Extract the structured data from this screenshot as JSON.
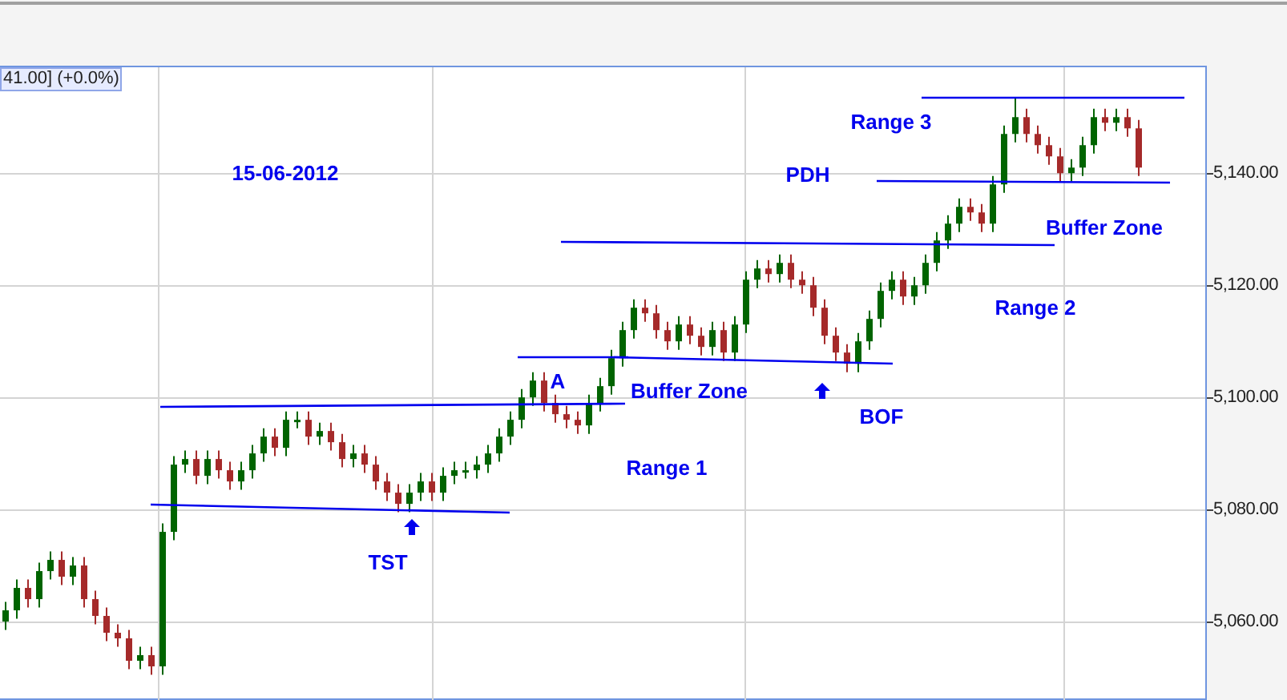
{
  "price_tag": "41.00] (+0.0%)",
  "annotations": [
    {
      "text": "15-06-2012"
    },
    {
      "text": "Range 3"
    },
    {
      "text": "PDH"
    },
    {
      "text": "Buffer Zone"
    },
    {
      "text": "Range 2"
    },
    {
      "text": "A"
    },
    {
      "text": "Buffer Zone"
    },
    {
      "text": "BOF"
    },
    {
      "text": "Range 1"
    },
    {
      "text": "TST"
    }
  ],
  "chart_data": {
    "type": "candlestick",
    "grid": true,
    "ylim": [
      5046,
      5158.9
    ],
    "yticks": [
      {
        "value": 5140,
        "label": "5,140.00"
      },
      {
        "value": 5120,
        "label": "5,120.00"
      },
      {
        "value": 5100,
        "label": "5,100.00"
      },
      {
        "value": 5080,
        "label": "5,080.00"
      },
      {
        "value": 5060,
        "label": "5,060.00"
      }
    ],
    "ohlc": [
      [
        5060,
        5063.5,
        5058.5,
        5062
      ],
      [
        5062,
        5067.5,
        5060.5,
        5066
      ],
      [
        5066,
        5067.5,
        5062.5,
        5064
      ],
      [
        5064,
        5070.5,
        5062.5,
        5069
      ],
      [
        5069,
        5072.5,
        5067.5,
        5071
      ],
      [
        5071,
        5072.5,
        5066.5,
        5068
      ],
      [
        5068,
        5071.5,
        5066.5,
        5070
      ],
      [
        5070,
        5071.5,
        5062.5,
        5064
      ],
      [
        5064,
        5065.5,
        5059.5,
        5061
      ],
      [
        5061,
        5062.5,
        5056.5,
        5058
      ],
      [
        5058,
        5059.5,
        5055.5,
        5057
      ],
      [
        5057,
        5058.5,
        5051.5,
        5053
      ],
      [
        5053,
        5055.5,
        5051.5,
        5054
      ],
      [
        5054,
        5055.5,
        5050.5,
        5052
      ],
      [
        5052,
        5077.5,
        5050.5,
        5076
      ],
      [
        5076,
        5089.5,
        5074.5,
        5088
      ],
      [
        5088,
        5090.5,
        5086.5,
        5089
      ],
      [
        5089,
        5090.5,
        5084.5,
        5086
      ],
      [
        5086,
        5090.5,
        5084.5,
        5089
      ],
      [
        5089,
        5090.5,
        5085.5,
        5087
      ],
      [
        5087,
        5088.5,
        5083.5,
        5085
      ],
      [
        5085,
        5088.5,
        5083.5,
        5087
      ],
      [
        5087,
        5091.5,
        5085.5,
        5090
      ],
      [
        5090,
        5094.5,
        5088.5,
        5093
      ],
      [
        5093,
        5094.5,
        5089.5,
        5091
      ],
      [
        5091,
        5097.5,
        5089.5,
        5096
      ],
      [
        5096,
        5097.5,
        5094.5,
        5096
      ],
      [
        5096,
        5097.5,
        5091.5,
        5093
      ],
      [
        5093,
        5095.5,
        5091.5,
        5094
      ],
      [
        5094,
        5095.5,
        5090.5,
        5092
      ],
      [
        5092,
        5093.5,
        5087.5,
        5089
      ],
      [
        5089,
        5091.5,
        5087.5,
        5090
      ],
      [
        5090,
        5091.5,
        5086.5,
        5088
      ],
      [
        5088,
        5089.5,
        5083.5,
        5085
      ],
      [
        5085,
        5086.5,
        5081.5,
        5083
      ],
      [
        5083,
        5084.5,
        5079.5,
        5081
      ],
      [
        5081,
        5084.5,
        5079.5,
        5083
      ],
      [
        5083,
        5086.5,
        5081.5,
        5085
      ],
      [
        5085,
        5086.5,
        5081.5,
        5083
      ],
      [
        5083,
        5087.5,
        5081.5,
        5086
      ],
      [
        5086,
        5088.5,
        5084.5,
        5087
      ],
      [
        5087,
        5088.5,
        5085.5,
        5087
      ],
      [
        5087,
        5089.5,
        5085.5,
        5088
      ],
      [
        5088,
        5091.5,
        5086.5,
        5090
      ],
      [
        5090,
        5094.5,
        5088.5,
        5093
      ],
      [
        5093,
        5097.5,
        5091.5,
        5096
      ],
      [
        5096,
        5101.5,
        5094.5,
        5100
      ],
      [
        5100,
        5104.5,
        5098.5,
        5103
      ],
      [
        5103,
        5104.5,
        5097.5,
        5099
      ],
      [
        5099,
        5100.5,
        5095.5,
        5097
      ],
      [
        5097,
        5098.5,
        5094.5,
        5096
      ],
      [
        5096,
        5097.5,
        5093.5,
        5095
      ],
      [
        5095,
        5100.5,
        5093.5,
        5099
      ],
      [
        5099,
        5103.5,
        5097.5,
        5102
      ],
      [
        5102,
        5108.5,
        5100.5,
        5107
      ],
      [
        5107,
        5113.5,
        5105.5,
        5112
      ],
      [
        5112,
        5117.5,
        5110.5,
        5116
      ],
      [
        5116,
        5117.5,
        5113.5,
        5115
      ],
      [
        5115,
        5116.5,
        5110.5,
        5112
      ],
      [
        5112,
        5113.5,
        5108.5,
        5110
      ],
      [
        5110,
        5114.5,
        5108.5,
        5113
      ],
      [
        5113,
        5114.5,
        5109.5,
        5111
      ],
      [
        5111,
        5112.5,
        5107.5,
        5109
      ],
      [
        5109,
        5113.5,
        5107.5,
        5112
      ],
      [
        5112,
        5113.5,
        5106.5,
        5108
      ],
      [
        5108,
        5114.5,
        5106.5,
        5113
      ],
      [
        5113,
        5122.5,
        5111.5,
        5121
      ],
      [
        5121,
        5124.5,
        5119.5,
        5123
      ],
      [
        5123,
        5124.5,
        5120.5,
        5122
      ],
      [
        5122,
        5125.5,
        5120.5,
        5124
      ],
      [
        5124,
        5125.5,
        5119.5,
        5121
      ],
      [
        5121,
        5122.5,
        5118.5,
        5120
      ],
      [
        5120,
        5121.5,
        5114.5,
        5116
      ],
      [
        5116,
        5117.5,
        5109.5,
        5111
      ],
      [
        5111,
        5112.5,
        5106.5,
        5108
      ],
      [
        5108,
        5109.5,
        5104.5,
        5106
      ],
      [
        5106,
        5111.5,
        5104.5,
        5110
      ],
      [
        5110,
        5115.5,
        5108.5,
        5114
      ],
      [
        5114,
        5120.5,
        5112.5,
        5119
      ],
      [
        5119,
        5122.5,
        5117.5,
        5121
      ],
      [
        5121,
        5122.5,
        5116.5,
        5118
      ],
      [
        5118,
        5121.5,
        5116.5,
        5120
      ],
      [
        5120,
        5125.5,
        5118.5,
        5124
      ],
      [
        5124,
        5129.5,
        5122.5,
        5128
      ],
      [
        5128,
        5132.5,
        5126.5,
        5131
      ],
      [
        5131,
        5135.5,
        5129.5,
        5134
      ],
      [
        5134,
        5135.5,
        5131.5,
        5133
      ],
      [
        5133,
        5134.5,
        5129.5,
        5131
      ],
      [
        5131,
        5139.5,
        5129.5,
        5138
      ],
      [
        5138,
        5148.5,
        5136.5,
        5147
      ],
      [
        5147,
        5153.5,
        5145.5,
        5150
      ],
      [
        5150,
        5151.5,
        5145.5,
        5147
      ],
      [
        5147,
        5148.5,
        5143.5,
        5145
      ],
      [
        5145,
        5146.5,
        5141.5,
        5143
      ],
      [
        5143,
        5144.5,
        5138.5,
        5140
      ],
      [
        5140,
        5142.5,
        5138.5,
        5141
      ],
      [
        5141,
        5146.5,
        5139.5,
        5145
      ],
      [
        5145,
        5151.5,
        5143.5,
        5150
      ],
      [
        5150,
        5151.5,
        5147.5,
        5149
      ],
      [
        5149,
        5151.5,
        5147.5,
        5150
      ],
      [
        5150,
        5151.5,
        5146.5,
        5148
      ],
      [
        5148,
        5149.5,
        5139.5,
        5141
      ]
    ]
  }
}
